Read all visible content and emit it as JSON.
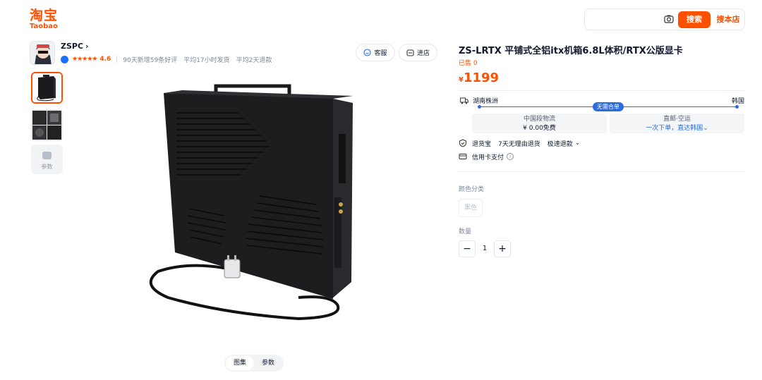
{
  "header": {
    "logo_cn": "淘宝",
    "logo_en": "Taobao",
    "search": {
      "placeholder": "",
      "search_button": "搜索",
      "store_button": "搜本店"
    }
  },
  "shop": {
    "name": "ZSPC",
    "chevron": "›",
    "stars": "★★★★★",
    "rating": "4.6",
    "stats": [
      "90天新增59条好评",
      "平均17小时发货",
      "平均2天退款"
    ],
    "customer_service": "客服",
    "enter_store": "进店"
  },
  "gallery": {
    "params_thumb_label": "参数",
    "tabs": [
      "图集",
      "参数"
    ],
    "active_tab": 0
  },
  "product": {
    "title": "ZS-LRTX 平铺式全铝itx机箱6.8L体积/RTX公版显卡",
    "sold": "已售 0",
    "currency": "¥",
    "price": "1199"
  },
  "shipping": {
    "from": "湖南株洲",
    "to": "韩国",
    "badge": "无需合单",
    "segment_domestic": {
      "title": "中国段物流",
      "detail": "¥ 0.00免费"
    },
    "segment_direct": {
      "title": "直邮·空运",
      "detail": "一次下单，直达韩国⌄"
    }
  },
  "services": {
    "return_insurance": "退货宝",
    "no_reason_return": "7天无理由退货",
    "fast_refund": "极速退款",
    "fast_refund_chevron": "⌄",
    "credit_card": "信用卡支付",
    "info_icon": "i"
  },
  "options": {
    "color_label": "颜色分类",
    "color_option": "黑色",
    "quantity_label": "数量",
    "minus": "−",
    "quantity": "1",
    "plus": "+"
  },
  "colors": {
    "brand": "#ff5000",
    "route_blue": "#2d6cdf"
  }
}
